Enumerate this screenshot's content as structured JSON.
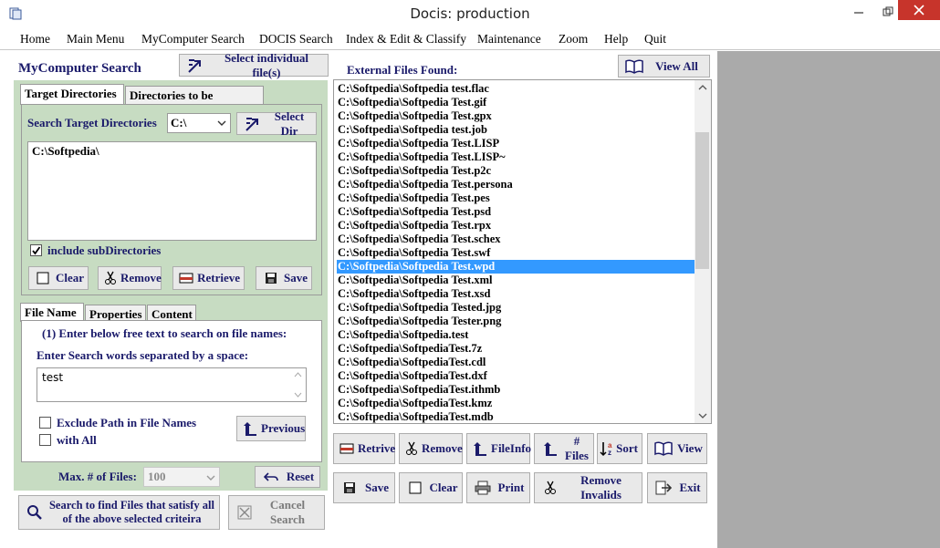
{
  "window": {
    "title": "Docis: production"
  },
  "menu": [
    "Home",
    "Main Menu",
    "MyComputer Search",
    "DOCIS Search",
    "Index & Edit & Classify",
    "Maintenance",
    "Zoom",
    "Help",
    "Quit"
  ],
  "left": {
    "title": "MyComputer Search",
    "select_files_label": "Select individual  file(s)",
    "tabs_top": [
      "Target Directories",
      "Directories to be Excluded"
    ],
    "search_target_label": "Search Target Directories",
    "drive_value": "C:\\",
    "select_dir_label": "Select Dir",
    "directories": [
      "C:\\Softpedia\\"
    ],
    "include_subdirs_label": "include subDirectories",
    "dir_buttons": [
      "Clear",
      "Remove",
      "Retrieve",
      "Save"
    ],
    "tabs_bottom": [
      "File Name",
      "Properties",
      "Content"
    ],
    "instruction": "(1) Enter below free text to search on file names:",
    "enter_words_label": "Enter Search words separated by a space:",
    "search_text": "test",
    "exclude_path_label": "Exclude Path in File Names",
    "with_all_label": "with All",
    "previous_label": "Previous",
    "max_files_label": "Max. # of Files:",
    "max_files_value": "100",
    "reset_label": "Reset",
    "search_button_label": "Search to find Files that satisfy all of the above selected criteira",
    "cancel_search_label": "Cancel Search"
  },
  "right": {
    "files_found_label": "External Files Found:",
    "view_all_label": "View All",
    "files": [
      "C:\\Softpedia\\Softpedia test.flac",
      "C:\\Softpedia\\Softpedia Test.gif",
      "C:\\Softpedia\\Softpedia Test.gpx",
      "C:\\Softpedia\\Softpedia test.job",
      "C:\\Softpedia\\Softpedia Test.LISP",
      "C:\\Softpedia\\Softpedia Test.LISP~",
      "C:\\Softpedia\\Softpedia Test.p2c",
      "C:\\Softpedia\\Softpedia Test.persona",
      "C:\\Softpedia\\Softpedia Test.pes",
      "C:\\Softpedia\\Softpedia Test.psd",
      "C:\\Softpedia\\Softpedia Test.rpx",
      "C:\\Softpedia\\Softpedia Test.schex",
      "C:\\Softpedia\\Softpedia Test.swf",
      "C:\\Softpedia\\Softpedia Test.wpd",
      "C:\\Softpedia\\Softpedia Test.xml",
      "C:\\Softpedia\\Softpedia Test.xsd",
      "C:\\Softpedia\\Softpedia Tested.jpg",
      "C:\\Softpedia\\Softpedia Tester.png",
      "C:\\Softpedia\\Softpedia.test",
      "C:\\Softpedia\\SoftpediaTest.7z",
      "C:\\Softpedia\\SoftpediaTest.cdl",
      "C:\\Softpedia\\SoftpediaTest.dxf",
      "C:\\Softpedia\\SoftpediaTest.ithmb",
      "C:\\Softpedia\\SoftpediaTest.kmz",
      "C:\\Softpedia\\SoftpediaTest.mdb"
    ],
    "selected_index": 13,
    "row1_buttons": [
      "Retrive",
      "Remove",
      "FileInfo",
      "# Files",
      "Sort",
      "View"
    ],
    "row2_buttons": [
      "Save",
      "Clear",
      "Print",
      "Remove Invalids",
      "Exit"
    ]
  }
}
